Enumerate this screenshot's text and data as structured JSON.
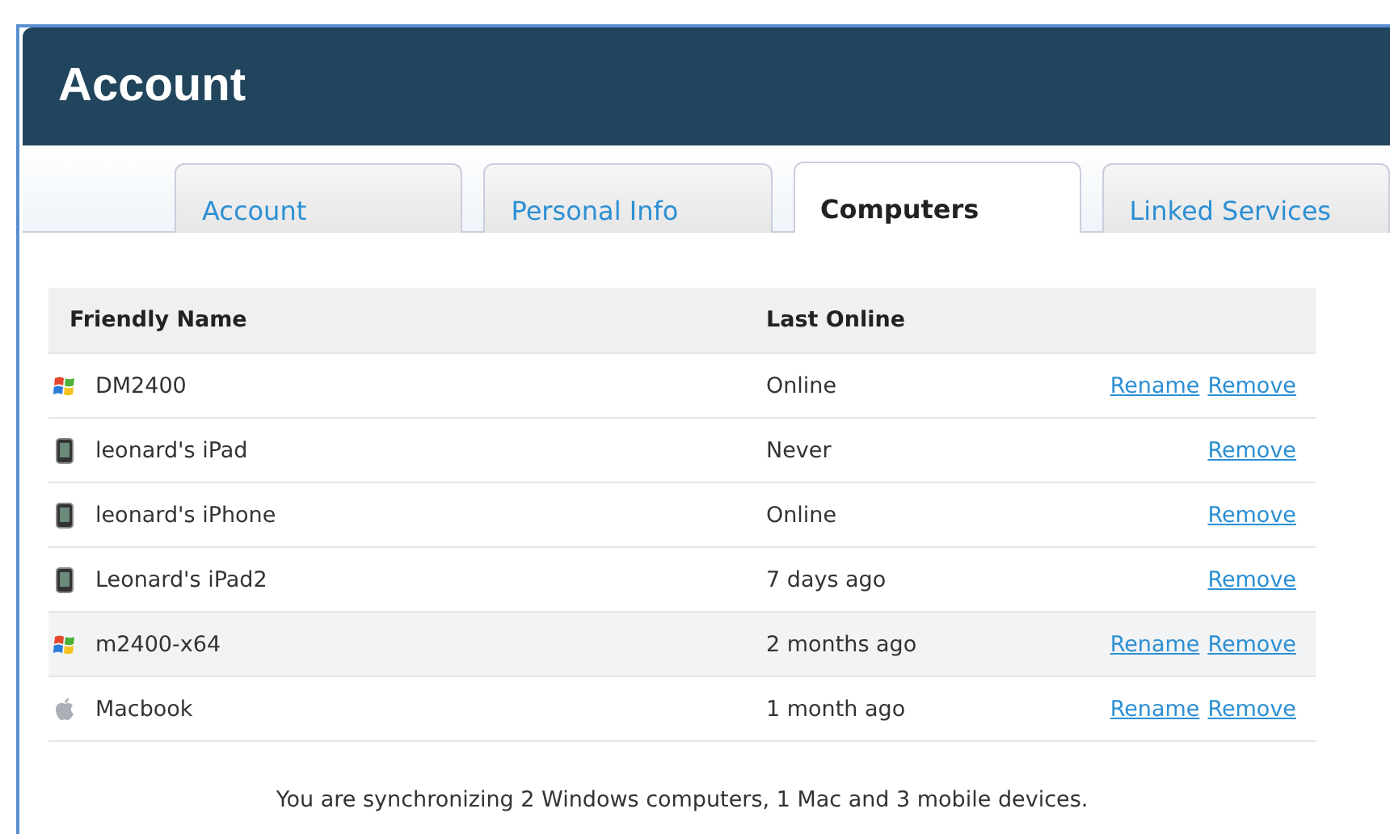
{
  "header": {
    "title": "Account"
  },
  "tabs": [
    {
      "label": "Account",
      "selected": false
    },
    {
      "label": "Personal Info",
      "selected": false
    },
    {
      "label": "Computers",
      "selected": true
    },
    {
      "label": "Linked Services",
      "selected": false
    }
  ],
  "table": {
    "columns": [
      "Friendly Name",
      "Last Online"
    ],
    "rows": [
      {
        "kind": "windows",
        "name": "DM2400",
        "last_online": "Online",
        "actions": [
          "Rename",
          "Remove"
        ],
        "highlighted": false
      },
      {
        "kind": "mobile",
        "name": "leonard's iPad",
        "last_online": "Never",
        "actions": [
          "Remove"
        ],
        "highlighted": false
      },
      {
        "kind": "mobile",
        "name": "leonard's iPhone",
        "last_online": "Online",
        "actions": [
          "Remove"
        ],
        "highlighted": false
      },
      {
        "kind": "mobile",
        "name": "Leonard's iPad2",
        "last_online": "7 days ago",
        "actions": [
          "Remove"
        ],
        "highlighted": false
      },
      {
        "kind": "windows",
        "name": "m2400-x64",
        "last_online": "2 months ago",
        "actions": [
          "Rename",
          "Remove"
        ],
        "highlighted": true
      },
      {
        "kind": "mac",
        "name": "Macbook",
        "last_online": "1 month ago",
        "actions": [
          "Rename",
          "Remove"
        ],
        "highlighted": false
      }
    ]
  },
  "summary": "You are synchronizing 2 Windows computers, 1 Mac and 3 mobile devices."
}
